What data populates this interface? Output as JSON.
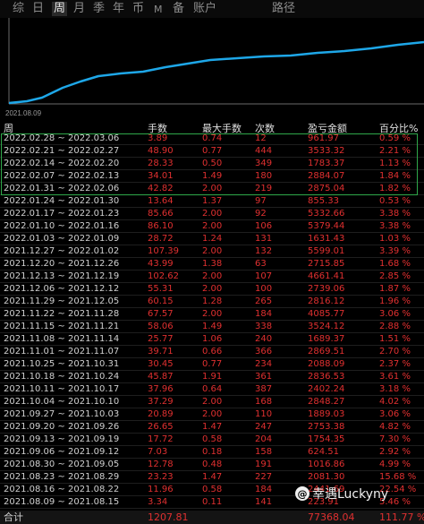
{
  "tabs": [
    {
      "label": "综",
      "active": false
    },
    {
      "label": "日",
      "active": false
    },
    {
      "label": "周",
      "active": true
    },
    {
      "label": "月",
      "active": false
    },
    {
      "label": "季",
      "active": false
    },
    {
      "label": "年",
      "active": false
    },
    {
      "label": "币",
      "active": false
    },
    {
      "label": "M",
      "active": false
    },
    {
      "label": "备",
      "active": false
    },
    {
      "label": "账户",
      "active": false
    },
    {
      "label": "路径",
      "active": false
    }
  ],
  "chart": {
    "start_label": "2021.08.09",
    "line_color": "#1ea7e8"
  },
  "table": {
    "headers": [
      "周",
      "手数",
      "最大手数",
      "次数",
      "盈亏金额",
      "百分比%"
    ],
    "rows": [
      [
        "2022.02.28 ~ 2022.03.06",
        "3.89",
        "0.74",
        "12",
        "961.97",
        "0.59 %"
      ],
      [
        "2022.02.21 ~ 2022.02.27",
        "48.90",
        "0.77",
        "444",
        "3533.32",
        "2.21 %"
      ],
      [
        "2022.02.14 ~ 2022.02.20",
        "28.33",
        "0.50",
        "349",
        "1783.37",
        "1.13 %"
      ],
      [
        "2022.02.07 ~ 2022.02.13",
        "34.01",
        "1.49",
        "180",
        "2884.07",
        "1.84 %"
      ],
      [
        "2022.01.31 ~ 2022.02.06",
        "42.82",
        "2.00",
        "219",
        "2875.04",
        "1.82 %"
      ],
      [
        "2022.01.24 ~ 2022.01.30",
        "13.64",
        "1.37",
        "97",
        "855.33",
        "0.53 %"
      ],
      [
        "2022.01.17 ~ 2022.01.23",
        "85.66",
        "2.00",
        "92",
        "5332.66",
        "3.38 %"
      ],
      [
        "2022.01.10 ~ 2022.01.16",
        "86.10",
        "2.00",
        "106",
        "5379.44",
        "3.38 %"
      ],
      [
        "2022.01.03 ~ 2022.01.09",
        "28.72",
        "1.24",
        "131",
        "1631.43",
        "1.03 %"
      ],
      [
        "2021.12.27 ~ 2022.01.02",
        "107.39",
        "2.00",
        "132",
        "5599.01",
        "3.39 %"
      ],
      [
        "2021.12.20 ~ 2021.12.26",
        "43.99",
        "1.38",
        "63",
        "2715.85",
        "1.68 %"
      ],
      [
        "2021.12.13 ~ 2021.12.19",
        "102.62",
        "2.00",
        "107",
        "4661.41",
        "2.85 %"
      ],
      [
        "2021.12.06 ~ 2021.12.12",
        "55.31",
        "2.00",
        "100",
        "2739.06",
        "1.87 %"
      ],
      [
        "2021.11.29 ~ 2021.12.05",
        "60.15",
        "1.28",
        "265",
        "2816.12",
        "1.96 %"
      ],
      [
        "2021.11.22 ~ 2021.11.28",
        "67.57",
        "2.00",
        "184",
        "4085.77",
        "3.06 %"
      ],
      [
        "2021.11.15 ~ 2021.11.21",
        "58.06",
        "1.49",
        "338",
        "3524.12",
        "2.88 %"
      ],
      [
        "2021.11.08 ~ 2021.11.14",
        "25.77",
        "1.06",
        "240",
        "1689.37",
        "1.51 %"
      ],
      [
        "2021.11.01 ~ 2021.11.07",
        "39.71",
        "0.66",
        "366",
        "2869.51",
        "2.70 %"
      ],
      [
        "2021.10.25 ~ 2021.10.31",
        "30.45",
        "0.77",
        "234",
        "2088.09",
        "2.37 %"
      ],
      [
        "2021.10.18 ~ 2021.10.24",
        "45.87",
        "1.91",
        "361",
        "2836.53",
        "3.61 %"
      ],
      [
        "2021.10.11 ~ 2021.10.17",
        "37.96",
        "0.64",
        "387",
        "2402.24",
        "3.18 %"
      ],
      [
        "2021.10.04 ~ 2021.10.10",
        "37.29",
        "2.00",
        "168",
        "2848.27",
        "4.02 %"
      ],
      [
        "2021.09.27 ~ 2021.10.03",
        "20.89",
        "2.00",
        "110",
        "1889.03",
        "3.06 %"
      ],
      [
        "2021.09.20 ~ 2021.09.26",
        "26.65",
        "1.47",
        "247",
        "2753.38",
        "4.82 %"
      ],
      [
        "2021.09.13 ~ 2021.09.19",
        "17.72",
        "0.58",
        "204",
        "1754.35",
        "7.30 %"
      ],
      [
        "2021.09.06 ~ 2021.09.12",
        "7.03",
        "0.18",
        "158",
        "624.51",
        "2.92 %"
      ],
      [
        "2021.08.30 ~ 2021.09.05",
        "12.78",
        "0.48",
        "191",
        "1016.86",
        "4.99 %"
      ],
      [
        "2021.08.23 ~ 2021.08.29",
        "23.23",
        "1.47",
        "227",
        "2081.30",
        "15.68 %"
      ],
      [
        "2021.08.16 ~ 2021.08.22",
        "11.96",
        "0.58",
        "184",
        "2441.69",
        "22.54 %"
      ],
      [
        "2021.08.09 ~ 2021.08.15",
        "3.34",
        "0.11",
        "141",
        "223.91",
        "5.46 %"
      ]
    ],
    "total": {
      "label": "合计",
      "lots": "1207.81",
      "amount": "77368.04",
      "percent": "111.77 %"
    }
  },
  "watermark": "幸遇Luckyny"
}
